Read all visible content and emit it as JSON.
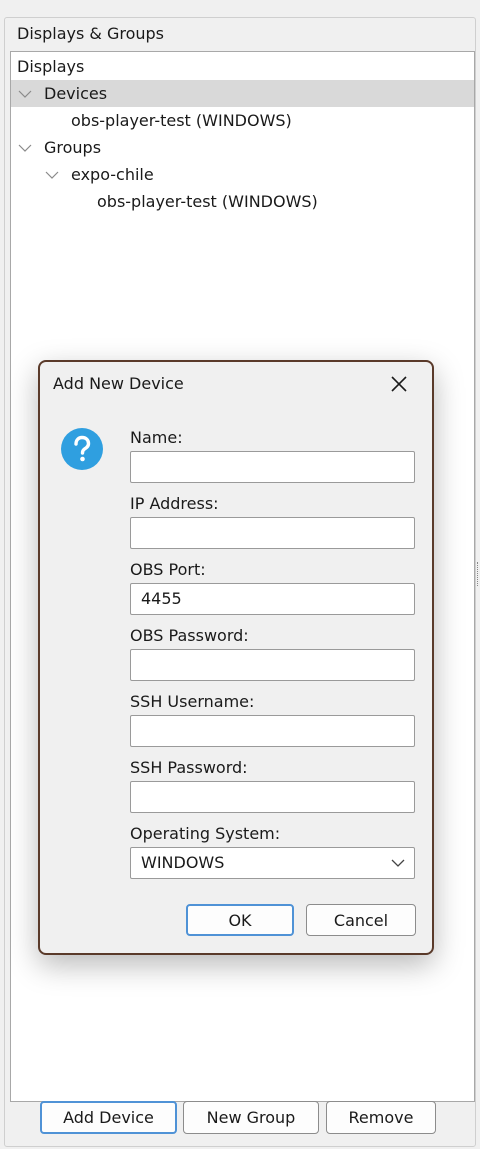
{
  "group": {
    "title": "Displays & Groups"
  },
  "tree": {
    "root": "Displays",
    "devices_label": "Devices",
    "device_item": "obs-player-test (WINDOWS)",
    "groups_label": "Groups",
    "group_name": "expo-chile",
    "group_device_item": "obs-player-test (WINDOWS)"
  },
  "buttons": {
    "add_device": "Add Device",
    "new_group": "New Group",
    "remove": "Remove"
  },
  "dialog": {
    "title": "Add New Device",
    "fields": {
      "name": {
        "label": "Name:",
        "value": ""
      },
      "ip": {
        "label": "IP Address:",
        "value": ""
      },
      "port": {
        "label": "OBS Port:",
        "value": "4455"
      },
      "obs_password": {
        "label": "OBS Password:",
        "value": ""
      },
      "ssh_username": {
        "label": "SSH Username:",
        "value": ""
      },
      "ssh_password": {
        "label": "SSH Password:",
        "value": ""
      },
      "os": {
        "label": "Operating System:",
        "value": "WINDOWS"
      }
    },
    "ok": "OK",
    "cancel": "Cancel"
  },
  "icons": {
    "question": "question-icon",
    "close": "close-icon",
    "chevron": "chevron-down-icon"
  },
  "colors": {
    "accent": "#2f9fe0",
    "selection": "#d9d9d9",
    "dialog_border": "#5a3a2a",
    "ok_border": "#4f92d6"
  }
}
